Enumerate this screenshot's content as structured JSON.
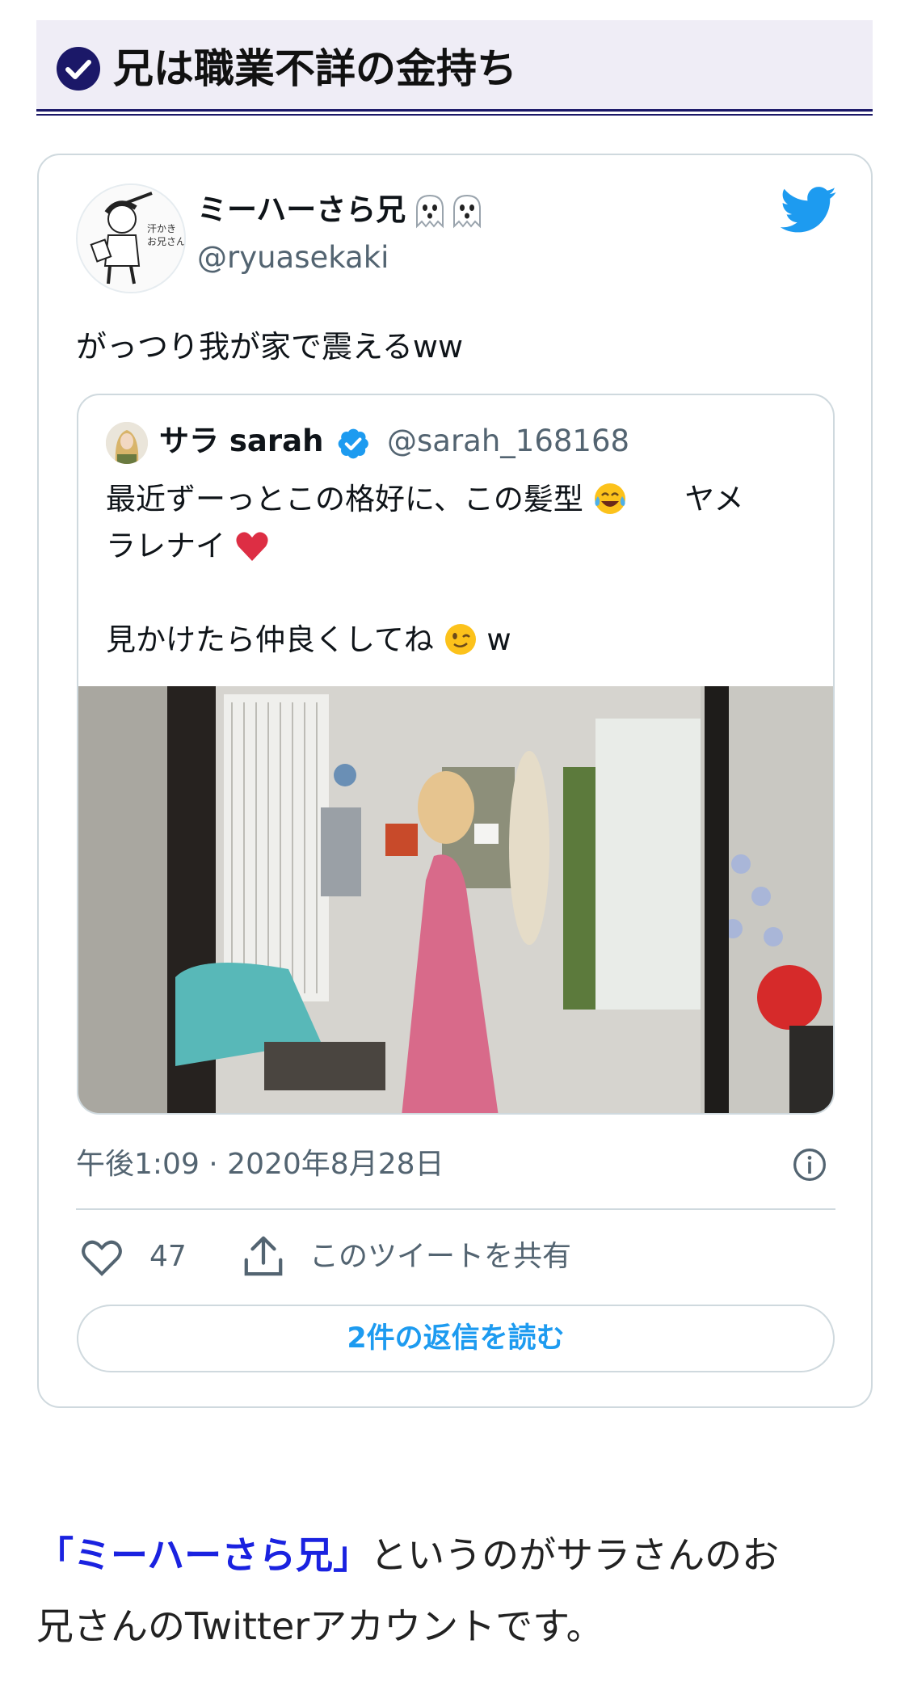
{
  "heading": {
    "title": "兄は職業不詳の金持ち"
  },
  "tweet": {
    "author_name": "ミーハーさら兄",
    "author_handle": "@ryuasekaki",
    "text": "がっつり我が家で震えるww",
    "quote": {
      "name": "サラ sarah",
      "handle": "@sarah_168168",
      "line1": "最近ずーっとこの格好に、この髪型",
      "line1_tail": "ヤメ",
      "line2": "ラレナイ",
      "line3": "見かけたら仲良くしてね",
      "line3_tail": "w"
    },
    "timestamp": "午後1:09 · 2020年8月28日",
    "like_count": "47",
    "share_label": "このツイートを共有",
    "replies_button": "2件の返信を読む"
  },
  "article": {
    "link_text": "「ミーハーさら兄」",
    "text_line1": "というのがサラさんのお",
    "text_line2": "兄さんのTwitterアカウントです。"
  },
  "colors": {
    "accent_blue": "#1d9bf0",
    "heading_navy": "#1b1868",
    "link_blue": "#1a22e0"
  },
  "icons": [
    "check-circle-icon",
    "ghost-icon",
    "twitter-bird-icon",
    "verified-badge-icon",
    "info-icon",
    "heart-icon",
    "share-icon"
  ]
}
